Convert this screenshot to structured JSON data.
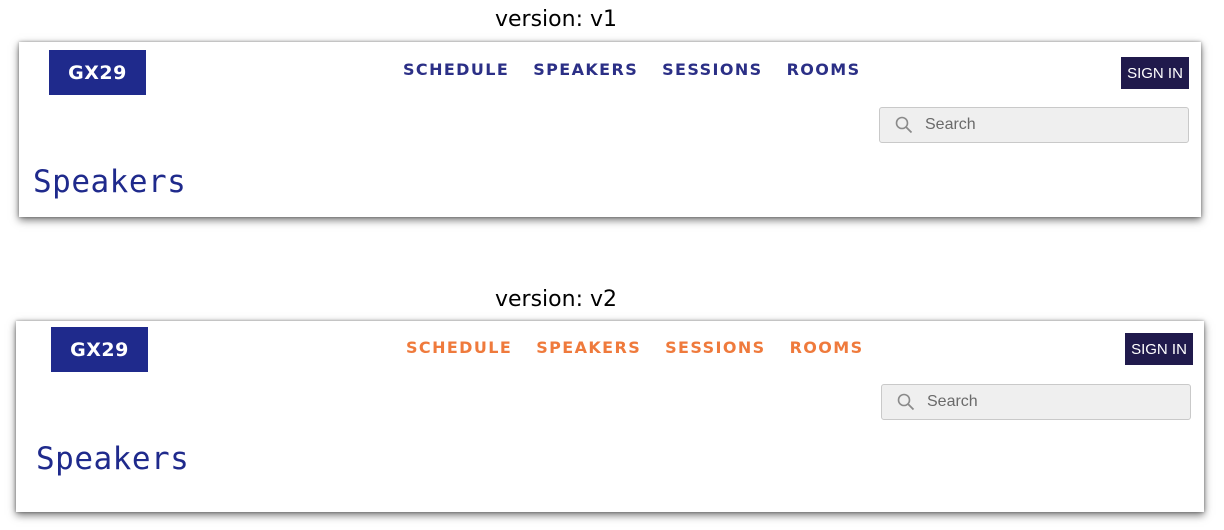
{
  "versions": [
    {
      "label": "version: v1",
      "logo": "GX29",
      "nav": [
        "SCHEDULE",
        "SPEAKERS",
        "SESSIONS",
        "ROOMS"
      ],
      "nav_color": "#2b2f86",
      "sign_in": "SIGN IN",
      "search_placeholder": "Search",
      "page_title": "Speakers"
    },
    {
      "label": "version: v2",
      "logo": "GX29",
      "nav": [
        "SCHEDULE",
        "SPEAKERS",
        "SESSIONS",
        "ROOMS"
      ],
      "nav_color": "#ef7a3c",
      "sign_in": "SIGN IN",
      "search_placeholder": "Search",
      "page_title": "Speakers"
    }
  ],
  "colors": {
    "brand": "#1f2a8c",
    "sign_in_bg": "#201a4c"
  }
}
